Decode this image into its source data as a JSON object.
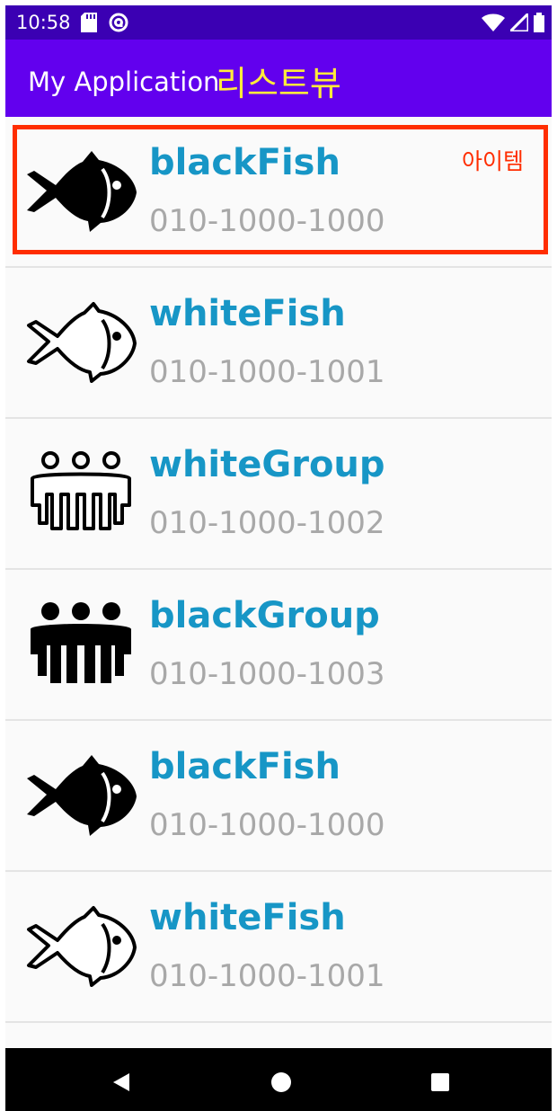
{
  "status_bar": {
    "time": "10:58",
    "icons": [
      "sd-card-icon",
      "circle-a-icon",
      "wifi-icon",
      "signal-icon",
      "battery-icon"
    ]
  },
  "app_bar": {
    "title": "My Application",
    "title_korean": "리스트뷰",
    "background": "#6200ee",
    "title_korean_color": "#ffeb3b"
  },
  "list": {
    "items": [
      {
        "name": "blackFish",
        "phone": "010-1000-1000",
        "icon": "black-fish-icon"
      },
      {
        "name": "whiteFish",
        "phone": "010-1000-1001",
        "icon": "white-fish-icon"
      },
      {
        "name": "whiteGroup",
        "phone": "010-1000-1002",
        "icon": "white-group-icon"
      },
      {
        "name": "blackGroup",
        "phone": "010-1000-1003",
        "icon": "black-group-icon"
      },
      {
        "name": "blackFish",
        "phone": "010-1000-1000",
        "icon": "black-fish-icon"
      },
      {
        "name": "whiteFish",
        "phone": "010-1000-1001",
        "icon": "white-fish-icon"
      }
    ],
    "name_color": "#1796c6",
    "phone_color": "#a8a8a8"
  },
  "annotation": {
    "label": "아이템",
    "color": "#ff2d00"
  },
  "nav_bar": {
    "buttons": [
      "back-icon",
      "home-icon",
      "recents-icon"
    ]
  }
}
